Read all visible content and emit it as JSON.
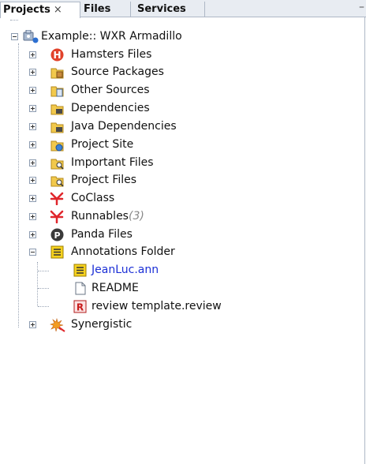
{
  "tabs": [
    {
      "label": "Projects",
      "close": "×"
    },
    {
      "label": "Files"
    },
    {
      "label": "Services"
    }
  ],
  "minimize_glyph": "–",
  "tree": {
    "root": {
      "label": "Example:: WXR Armadillo",
      "icon": "project-folder-icon"
    },
    "items": [
      {
        "label": "Hamsters Files",
        "icon": "hamster-h-icon"
      },
      {
        "label": "Source Packages",
        "icon": "source-packages-icon"
      },
      {
        "label": "Other Sources",
        "icon": "other-sources-icon"
      },
      {
        "label": "Dependencies",
        "icon": "dependencies-icon"
      },
      {
        "label": "Java Dependencies",
        "icon": "java-dependencies-icon"
      },
      {
        "label": "Project Site",
        "icon": "project-site-icon"
      },
      {
        "label": "Important Files",
        "icon": "important-files-icon"
      },
      {
        "label": "Project Files",
        "icon": "project-files-icon"
      },
      {
        "label": "CoClass",
        "icon": "coclass-icon"
      },
      {
        "label": "Runnables",
        "count": "(3)",
        "icon": "runnables-icon"
      },
      {
        "label": "Panda Files",
        "icon": "panda-p-icon"
      },
      {
        "label": "Annotations Folder",
        "icon": "annotations-folder-icon",
        "children": [
          {
            "label": "JeanLuc.ann",
            "icon": "annotation-file-icon",
            "color": "#1b2fd6"
          },
          {
            "label": "README",
            "icon": "document-icon"
          },
          {
            "label": "review template.review",
            "icon": "review-file-icon"
          }
        ]
      },
      {
        "label": "Synergistic",
        "icon": "synergistic-icon"
      }
    ]
  },
  "colors": {
    "tab_bar": "#e8ecf2",
    "border": "#aeb8c6",
    "link_blue": "#1b2fd6",
    "hamster_red": "#e1412a",
    "coclass_red": "#e0262c",
    "folder_yellow": "#f2c94c"
  }
}
